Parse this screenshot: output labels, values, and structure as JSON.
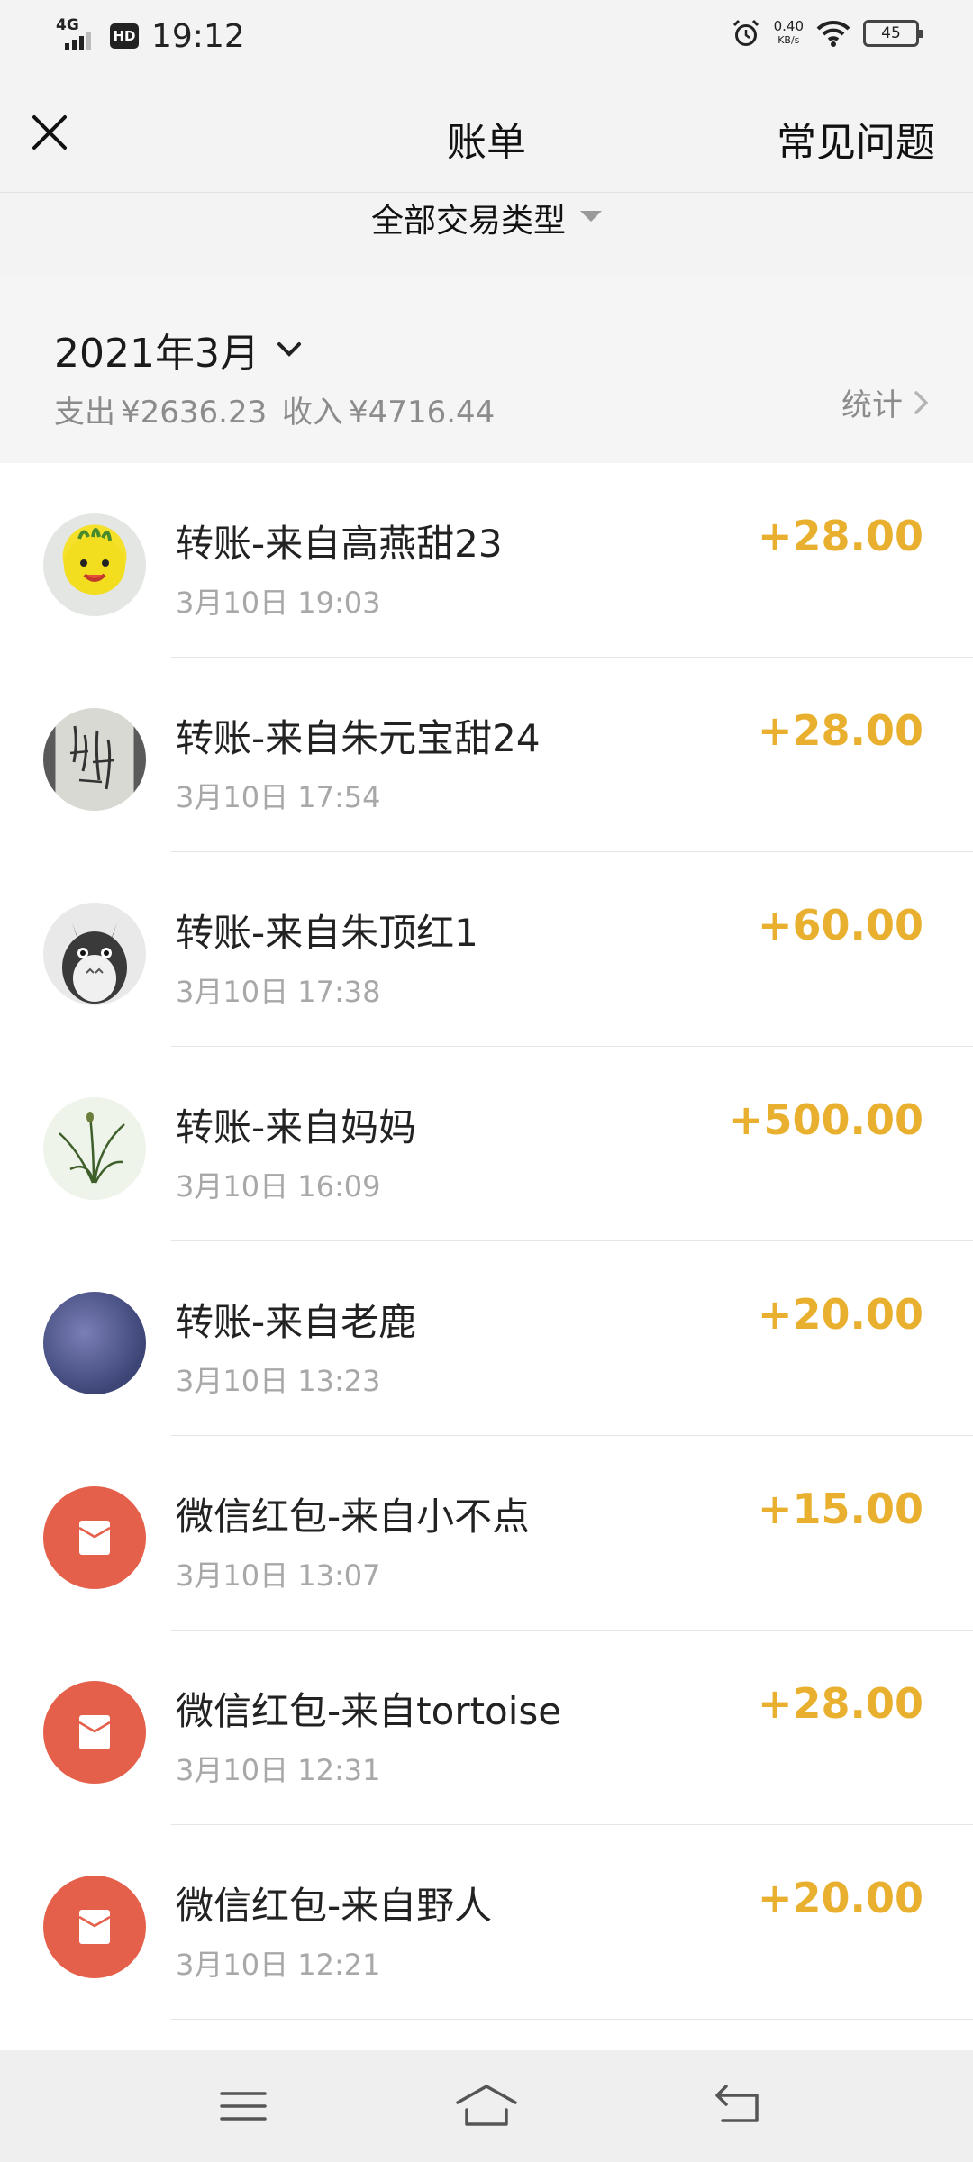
{
  "status_bar": {
    "network": "4G",
    "hd": "HD",
    "time": "19:12",
    "speed_value": "0.40",
    "speed_unit": "KB/s",
    "battery": "45"
  },
  "header": {
    "title": "账单",
    "faq_label": "常见问题"
  },
  "filter": {
    "label": "全部交易类型"
  },
  "summary": {
    "month": "2021年3月",
    "expense_label": "支出",
    "expense_value": "¥2636.23",
    "income_label": "收入",
    "income_value": "¥4716.44",
    "stats_label": "统计"
  },
  "transactions": [
    {
      "title": "转账-来自高燕甜23",
      "time": "3月10日 19:03",
      "amount": "+28.00"
    },
    {
      "title": "转账-来自朱元宝甜24",
      "time": "3月10日 17:54",
      "amount": "+28.00"
    },
    {
      "title": "转账-来自朱顶红1",
      "time": "3月10日 17:38",
      "amount": "+60.00"
    },
    {
      "title": "转账-来自妈妈",
      "time": "3月10日 16:09",
      "amount": "+500.00"
    },
    {
      "title": "转账-来自老鹿",
      "time": "3月10日 13:23",
      "amount": "+20.00"
    },
    {
      "title": "微信红包-来自小不点",
      "time": "3月10日 13:07",
      "amount": "+15.00"
    },
    {
      "title": "微信红包-来自tortoise",
      "time": "3月10日 12:31",
      "amount": "+28.00"
    },
    {
      "title": "微信红包-来自野人",
      "time": "3月10日 12:21",
      "amount": "+20.00"
    }
  ],
  "colors": {
    "amount": "#e8b02e",
    "red_packet": "#e5604a",
    "background_gray": "#f3f3f3"
  }
}
